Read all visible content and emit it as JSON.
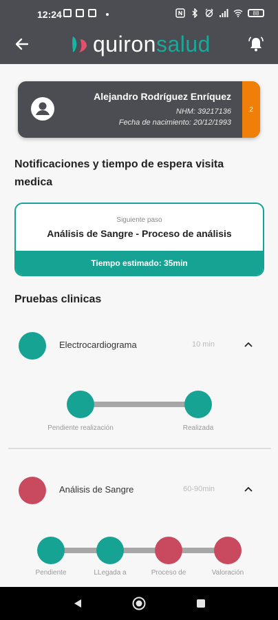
{
  "status_bar": {
    "time": "12:24",
    "battery": "88"
  },
  "header": {
    "logo": {
      "part1": "quiron",
      "part2": "salud"
    },
    "back_icon": "arrow-left-icon",
    "bell_icon": "bell-icon"
  },
  "patient": {
    "name": "Alejandro Rodríguez Enríquez",
    "nhm": "NHM: 39217136",
    "birth": "Fecha de nacimiento: 20/12/1993",
    "tab_label": "2"
  },
  "notifications": {
    "title": "Notificaciones y tiempo de espera visita medica",
    "next_step_label": "Siguiente paso",
    "next_step_value": "Análisis de Sangre - Proceso de análisis",
    "estimated_time": "Tiempo estimado: 35min"
  },
  "pruebas": {
    "title": "Pruebas clinicas",
    "tests": [
      {
        "name": "Electrocardiograma",
        "duration": "10 min",
        "color": "#16a394",
        "steps": [
          "Pendiente realización",
          "Realizada"
        ]
      },
      {
        "name": "Análisis de Sangre",
        "duration": "60-90min",
        "color": "#c94a5f",
        "steps": [
          "Pendiente",
          "LLegada a",
          "Proceso de",
          "Valoración"
        ]
      }
    ]
  },
  "colors": {
    "teal": "#16a394",
    "red": "#c94a5f",
    "orange": "#f07f0a",
    "header": "#4b4d52"
  }
}
